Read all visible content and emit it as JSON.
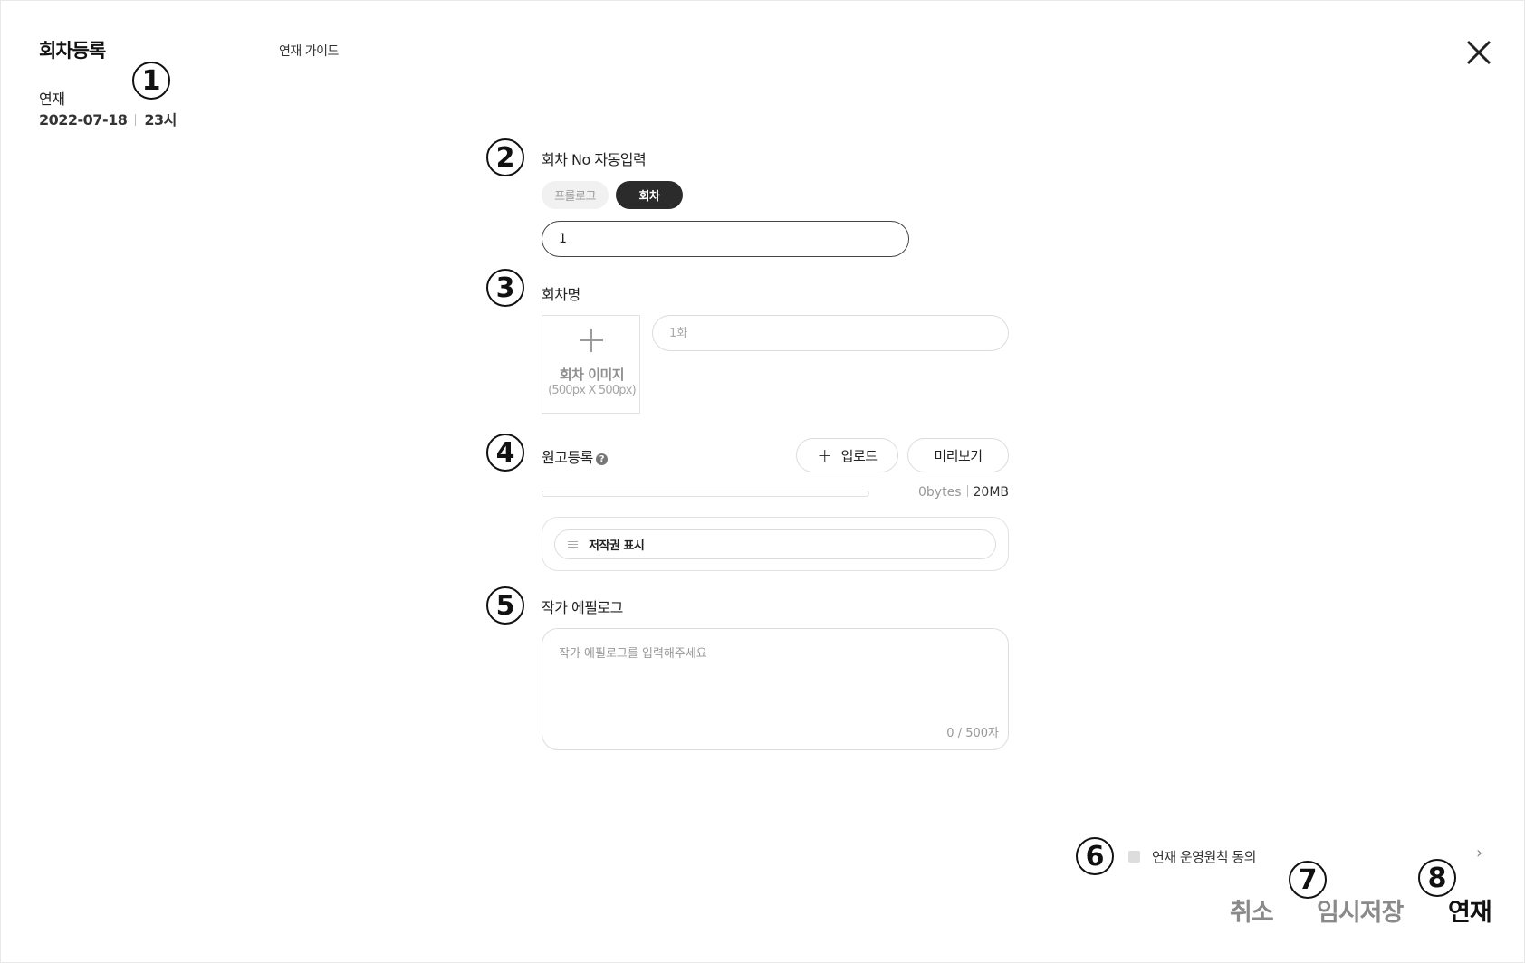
{
  "header": {
    "title": "회차등록",
    "guide_link": "연재 가이드",
    "close_icon": "close-icon"
  },
  "schedule": {
    "label": "연재",
    "date": "2022-07-18",
    "time": "23시"
  },
  "steps": [
    "1",
    "2",
    "3",
    "4",
    "5",
    "6",
    "7",
    "8"
  ],
  "episode_no": {
    "label": "회차 No 자동입력",
    "options": [
      "프롤로그",
      "회차"
    ],
    "selected": "회차",
    "value": "1"
  },
  "episode_title": {
    "label": "회차명",
    "image_label": "회차 이미지",
    "image_size": "(500px X 500px)",
    "placeholder": "1화"
  },
  "manuscript": {
    "label": "원고등록",
    "help_icon": "question-icon",
    "upload_label": "업로드",
    "preview_label": "미리보기",
    "size_used": "0bytes",
    "size_max": "20MB",
    "progress": 0,
    "files": [
      "저작권 표시"
    ]
  },
  "epilogue": {
    "label": "작가 에필로그",
    "placeholder": "작가 에필로그를 입력해주세요",
    "count": "0 / 500자"
  },
  "footer": {
    "agree_label": "연재 운영원칙 동의",
    "agreed": false,
    "cancel": "취소",
    "save_draft": "임시저장",
    "publish": "연재"
  }
}
